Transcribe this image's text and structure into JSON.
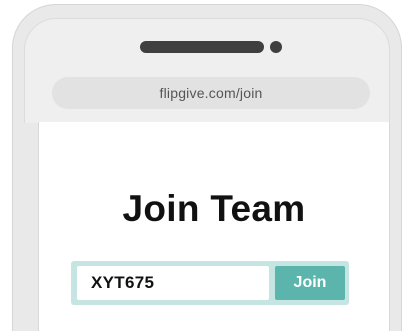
{
  "browser": {
    "url": "flipgive.com/join"
  },
  "page": {
    "title": "Join Team"
  },
  "join_form": {
    "code_value": "XYT675",
    "button_label": "Join"
  },
  "colors": {
    "accent": "#5bb5ad",
    "form_background": "#c5e5e2",
    "phone_body": "#e9e9e9"
  }
}
